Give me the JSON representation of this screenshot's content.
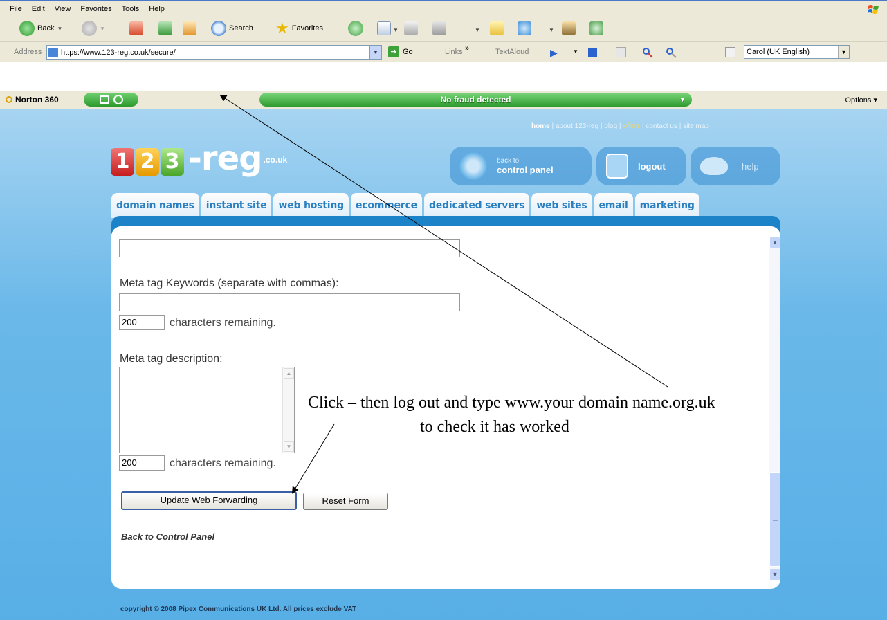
{
  "menubar": {
    "items": [
      "File",
      "Edit",
      "View",
      "Favorites",
      "Tools",
      "Help"
    ]
  },
  "toolbar": {
    "back_label": "Back",
    "search_label": "Search",
    "favorites_label": "Favorites"
  },
  "addressbar": {
    "label": "Address",
    "url": "https://www.123-reg.co.uk/secure/",
    "go_label": "Go",
    "links_label": "Links",
    "links_chevron": "»",
    "textaloud_label": "TextAloud",
    "voice_selected": "Carol (UK English)"
  },
  "norton": {
    "label": "Norton 360",
    "status": "No fraud detected",
    "options_label": "Options ▾"
  },
  "site": {
    "top_links": {
      "home": "home",
      "about": "about 123-reg",
      "blog": "blog",
      "offers": "offers",
      "contact": "contact us",
      "sitemap": "site map"
    },
    "logo": {
      "digit1": "1",
      "digit2": "2",
      "digit3": "3",
      "reg": "-reg",
      "suffix": ".co.uk"
    },
    "header_buttons": {
      "cp_small": "back to",
      "cp_big": "control panel",
      "logout": "logout",
      "help": "help"
    },
    "nav_tabs": [
      "domain names",
      "instant site",
      "web hosting",
      "ecommerce",
      "dedicated servers",
      "web sites",
      "email",
      "marketing"
    ],
    "form": {
      "keywords_label": "Meta tag Keywords (separate with commas):",
      "keywords_value": "",
      "keywords_count": "200",
      "characters_remaining": "characters remaining.",
      "description_label": "Meta tag description:",
      "description_value": "",
      "description_count": "200",
      "update_button": "Update Web Forwarding",
      "reset_button": "Reset Form",
      "back_link": "Back to Control Panel"
    },
    "footer": "copyright © 2008 Pipex Communications UK Ltd. All prices exclude VAT"
  },
  "annotation": {
    "line1": "Click – then log out and type www.your domain name.org.uk",
    "line2": "to check it has worked"
  },
  "colors": {
    "page_blue": "#58afe6",
    "nav_text": "#2a7fc0",
    "norton_green": "#2f9b2f",
    "offers_yellow": "#ffd640"
  }
}
